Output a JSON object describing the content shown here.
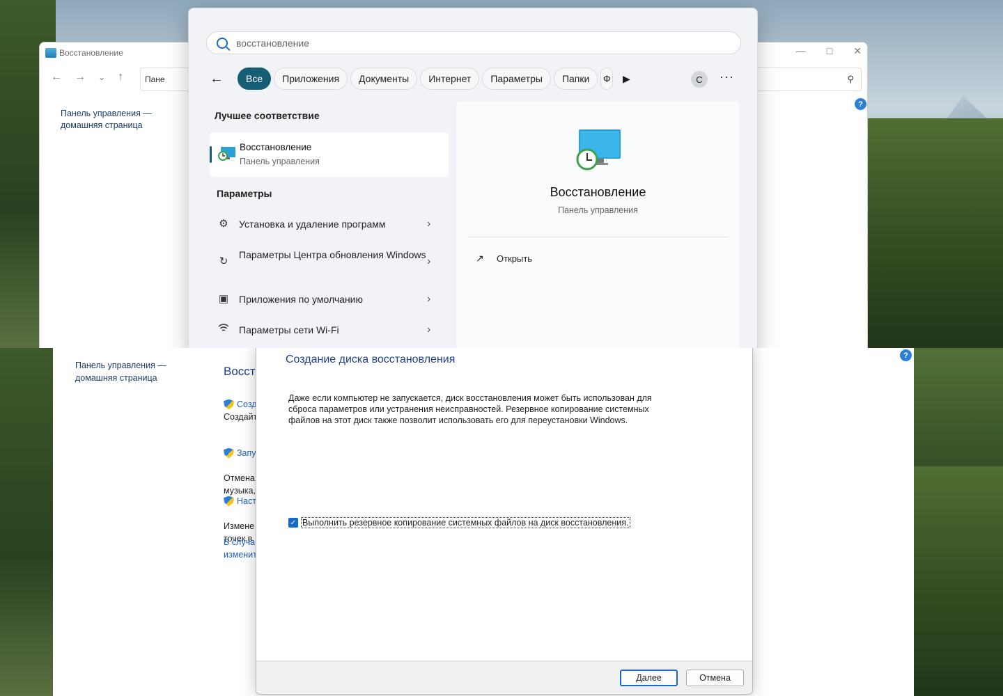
{
  "cp_top": {
    "title": "Восстановление",
    "address": "Пане",
    "home_link": "Панель управления — домашняя страница",
    "help": "?"
  },
  "search": {
    "query": "восстановление",
    "filters": [
      "Все",
      "Приложения",
      "Документы",
      "Интернет",
      "Параметры",
      "Папки"
    ],
    "filter_cut": "Ф",
    "avatar_letter": "С",
    "more": "···",
    "best_match_header": "Лучшее соответствие",
    "best_match": {
      "title": "Восстановление",
      "subtitle": "Панель управления"
    },
    "settings_header": "Параметры",
    "settings": [
      {
        "label": "Установка и удаление программ",
        "icon": "gear-icon"
      },
      {
        "label": "Параметры Центра обновления Windows",
        "icon": "sync-icon"
      },
      {
        "label": "Приложения по умолчанию",
        "icon": "default-apps-icon"
      },
      {
        "label": "Параметры сети Wi-Fi",
        "icon": "wifi-icon"
      }
    ],
    "preview": {
      "title": "Восстановление",
      "subtitle": "Панель управления",
      "open_label": "Открыть"
    }
  },
  "cp_bottom": {
    "home_link": "Панель управления — домашняя страница",
    "heading": "Восст",
    "items": [
      {
        "link": "Созд",
        "text": "Создайт"
      },
      {
        "link": "Запу",
        "text": "Отмена\nмузыка,"
      },
      {
        "link": "Наст",
        "text": "Измене\nточек в"
      }
    ],
    "footer_link": "В случа\nизменит",
    "help": "?"
  },
  "wizard": {
    "title": "Создание диска восстановления",
    "description": "Даже если компьютер не запускается, диск восстановления может быть использован для сброса параметров или устранения неисправностей. Резервное копирование системных файлов на этот диск также позволит использовать его для переустановки Windows.",
    "checkbox_label": "Выполнить резервное копирование системных файлов на диск восстановления.",
    "checkbox_checked": true,
    "next_label": "Далее",
    "cancel_label": "Отмена"
  },
  "colors": {
    "accent": "#155e75",
    "link": "#1e5fbf",
    "heading": "#1e3f8a"
  }
}
